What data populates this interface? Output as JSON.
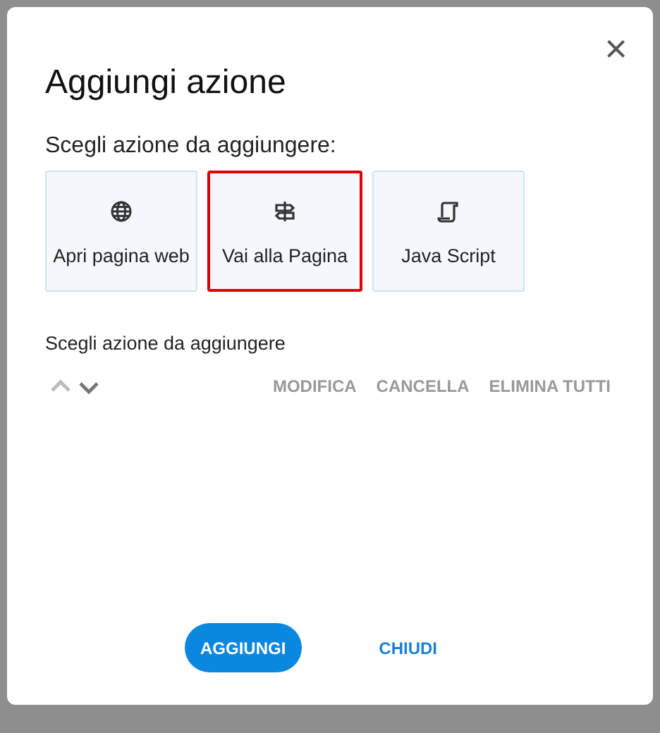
{
  "dialog": {
    "title": "Aggiungi azione",
    "close": "×",
    "prompt": "Scegli azione da aggiungere:",
    "actions": [
      {
        "kind": "globe",
        "label": "Apri pagina web",
        "selected": false
      },
      {
        "kind": "signpost",
        "label": "Vai alla Pagina",
        "selected": true
      },
      {
        "kind": "script",
        "label": "Java Script",
        "selected": false
      }
    ],
    "list_label": "Scegli azione da aggiungere",
    "move_buttons": [
      {
        "kind": "up",
        "disabled": true
      },
      {
        "kind": "down",
        "disabled": false
      }
    ],
    "list_actions": [
      "MODIFICA",
      "CANCELLA",
      "ELIMINA TUTTI"
    ],
    "buttons": [
      {
        "kind": "primary",
        "label": "AGGIUNGI"
      },
      {
        "kind": "text",
        "label": "CHIUDI"
      }
    ]
  }
}
